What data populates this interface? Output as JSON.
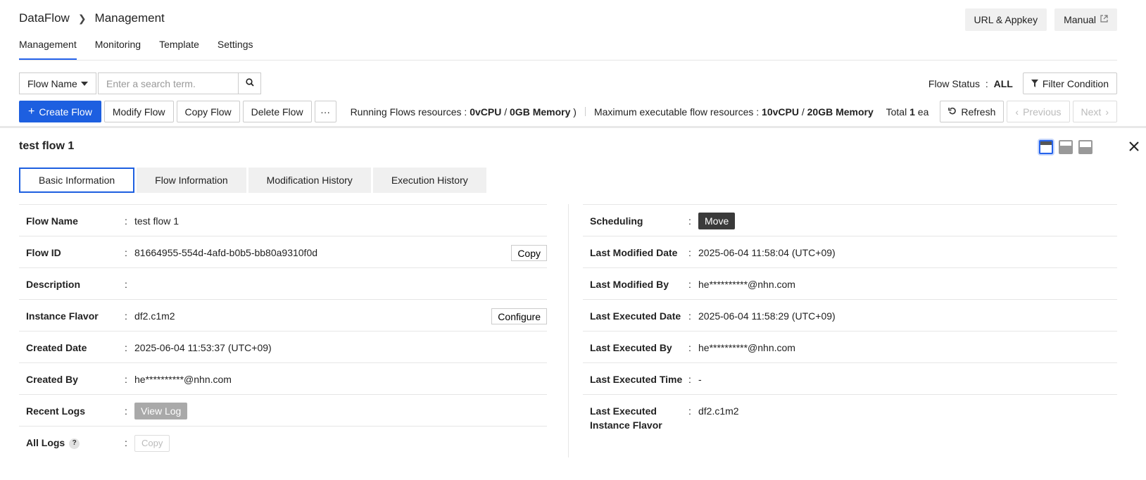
{
  "breadcrumb": {
    "root": "DataFlow",
    "current": "Management"
  },
  "header_buttons": {
    "url_appkey": "URL & Appkey",
    "manual": "Manual"
  },
  "main_tabs": [
    {
      "label": "Management",
      "active": true
    },
    {
      "label": "Monitoring"
    },
    {
      "label": "Template"
    },
    {
      "label": "Settings"
    }
  ],
  "search": {
    "select_label": "Flow Name",
    "placeholder": "Enter a search term."
  },
  "flow_status": {
    "label": "Flow Status",
    "value": "ALL",
    "filter_button": "Filter Condition"
  },
  "actions": {
    "create": "Create Flow",
    "modify": "Modify Flow",
    "copy": "Copy Flow",
    "delete": "Delete Flow",
    "more": "···"
  },
  "resources": {
    "running_label": "Running Flows resources :",
    "running_cpu": "0vCPU",
    "running_mem": "0GB Memory",
    "max_label": "Maximum executable flow resources :",
    "max_cpu": "10vCPU",
    "max_mem": "20GB Memory"
  },
  "paging": {
    "total_label": "Total",
    "total_count": "1",
    "total_unit": "ea",
    "refresh": "Refresh",
    "previous": "Previous",
    "next": "Next"
  },
  "detail": {
    "title": "test flow 1",
    "tabs": [
      "Basic Information",
      "Flow Information",
      "Modification History",
      "Execution History"
    ],
    "left": {
      "flow_name": {
        "label": "Flow Name",
        "value": "test flow 1"
      },
      "flow_id": {
        "label": "Flow ID",
        "value": "81664955-554d-4afd-b0b5-bb80a9310f0d",
        "action": "Copy"
      },
      "description": {
        "label": "Description",
        "value": ""
      },
      "instance_flavor": {
        "label": "Instance Flavor",
        "value": "df2.c1m2",
        "action": "Configure"
      },
      "created_date": {
        "label": "Created Date",
        "value": "2025-06-04 11:53:37 (UTC+09)"
      },
      "created_by": {
        "label": "Created By",
        "value": "he**********@nhn.com"
      },
      "recent_logs": {
        "label": "Recent Logs",
        "action": "View Log"
      },
      "all_logs": {
        "label": "All Logs",
        "help": "?",
        "action": "Copy"
      }
    },
    "right": {
      "scheduling": {
        "label": "Scheduling",
        "action": "Move"
      },
      "last_modified_date": {
        "label": "Last Modified Date",
        "value": "2025-06-04 11:58:04 (UTC+09)"
      },
      "last_modified_by": {
        "label": "Last Modified By",
        "value": "he**********@nhn.com"
      },
      "last_executed_date": {
        "label": "Last Executed Date",
        "value": "2025-06-04 11:58:29 (UTC+09)"
      },
      "last_executed_by": {
        "label": "Last Executed By",
        "value": "he**********@nhn.com"
      },
      "last_executed_time": {
        "label": "Last Executed Time",
        "value": "-"
      },
      "last_executed_flavor": {
        "label": "Last Executed Instance Flavor",
        "value": "df2.c1m2"
      }
    }
  },
  "icons": {
    "search": "search-icon",
    "plus": "plus-icon",
    "filter": "filter-icon",
    "refresh": "refresh-icon",
    "external": "external-link-icon",
    "close": "close-icon"
  },
  "colors": {
    "primary": "#1d5fe0",
    "accent_tab": "#2563eb"
  }
}
